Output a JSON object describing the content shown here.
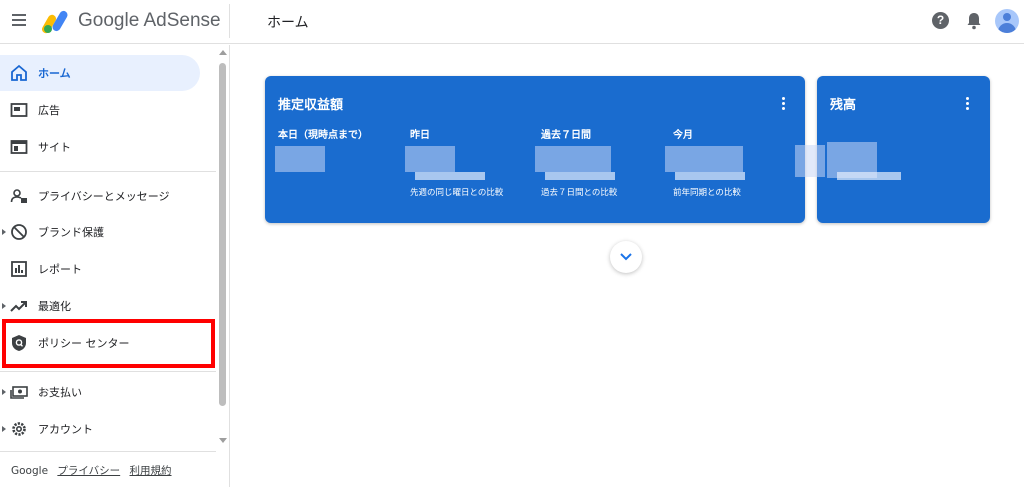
{
  "header": {
    "brand": "Google AdSense",
    "page_title": "ホーム",
    "help_glyph": "?"
  },
  "sidebar": {
    "items": [
      {
        "label": "ホーム",
        "icon": "home-icon",
        "active": true
      },
      {
        "label": "広告",
        "icon": "ads-icon"
      },
      {
        "label": "サイト",
        "icon": "sites-icon"
      },
      {
        "label": "プライバシーとメッセージ",
        "icon": "privacy-icon"
      },
      {
        "label": "ブランド保護",
        "icon": "block-icon"
      },
      {
        "label": "レポート",
        "icon": "report-icon"
      },
      {
        "label": "最適化",
        "icon": "trending-up-icon"
      },
      {
        "label": "ポリシー センター",
        "icon": "policy-shield-icon",
        "highlighted": true
      },
      {
        "label": "お支払い",
        "icon": "payments-icon"
      },
      {
        "label": "アカウント",
        "icon": "gear-icon"
      }
    ],
    "footer": {
      "google": "Google",
      "privacy": "プライバシー",
      "terms": "利用規約"
    }
  },
  "earnings_card": {
    "title": "推定収益額",
    "columns": [
      {
        "label": "本日（現時点まで）",
        "comparison": ""
      },
      {
        "label": "昨日",
        "comparison": "先週の同じ曜日との比較"
      },
      {
        "label": "過去７日間",
        "comparison": "過去７日間との比較"
      },
      {
        "label": "今月",
        "comparison": "前年同期との比較"
      }
    ]
  },
  "balance_card": {
    "title": "残高"
  },
  "colors": {
    "card_blue": "#1a6ccf",
    "active_bg": "#e8f0fe",
    "active_text": "#1967d2",
    "highlight": "#ff0000"
  }
}
